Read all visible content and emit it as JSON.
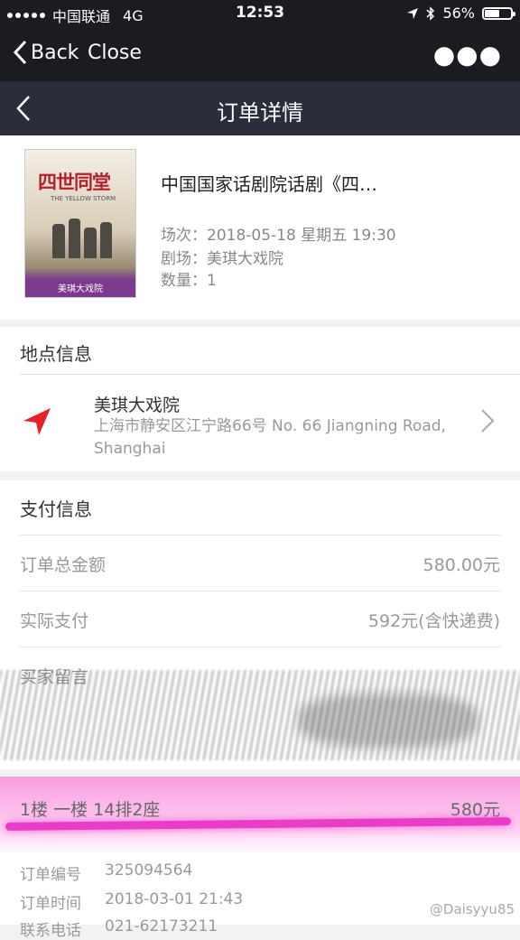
{
  "status_bar": {
    "carrier": "中国联通",
    "network": "4G",
    "time": "12:53",
    "battery": "56%",
    "battery_level": 0.56
  },
  "wechat_bar": {
    "back_label": "Back",
    "close_label": "Close",
    "more_icon": "more-dots-icon"
  },
  "page": {
    "title": "订单详情"
  },
  "ticket": {
    "poster": {
      "title": "四世同堂",
      "subtitle": "THE YELLOW STORM",
      "footer": "美琪大戏院"
    },
    "name": "中国国家话剧院话剧《四…",
    "session": "场次：2018-05-18 星期五 19:30",
    "venue": "剧场：美琪大戏院",
    "quantity": "数量：1"
  },
  "location": {
    "section_title": "地点信息",
    "venue_name": "美琪大戏院",
    "address": "上海市静安区江宁路66号 No. 66 Jiangning Road, Shanghai"
  },
  "payment": {
    "section_title": "支付信息",
    "total_label": "订单总金额",
    "total_value": "580.00元",
    "paid_label": "实际支付",
    "paid_value": "592元(含快递费)",
    "note_label": "买家留言"
  },
  "seat": {
    "seat_label": "1楼 一楼 14排2座",
    "seat_price": "580元",
    "order_no_label": "订单编号",
    "order_no_value": "325094564",
    "order_time_label": "订单时间",
    "order_time_value": "2018-03-01 21:43",
    "contact_label": "联系电话",
    "contact_value": "021-62173211"
  },
  "watermark": "@Daisyyu85",
  "colors": {
    "nav_bg": "#2a2e3a",
    "status_bg": "#1b1c21",
    "location_arrow": "#e8202a",
    "highlight": "#e93cc8"
  }
}
